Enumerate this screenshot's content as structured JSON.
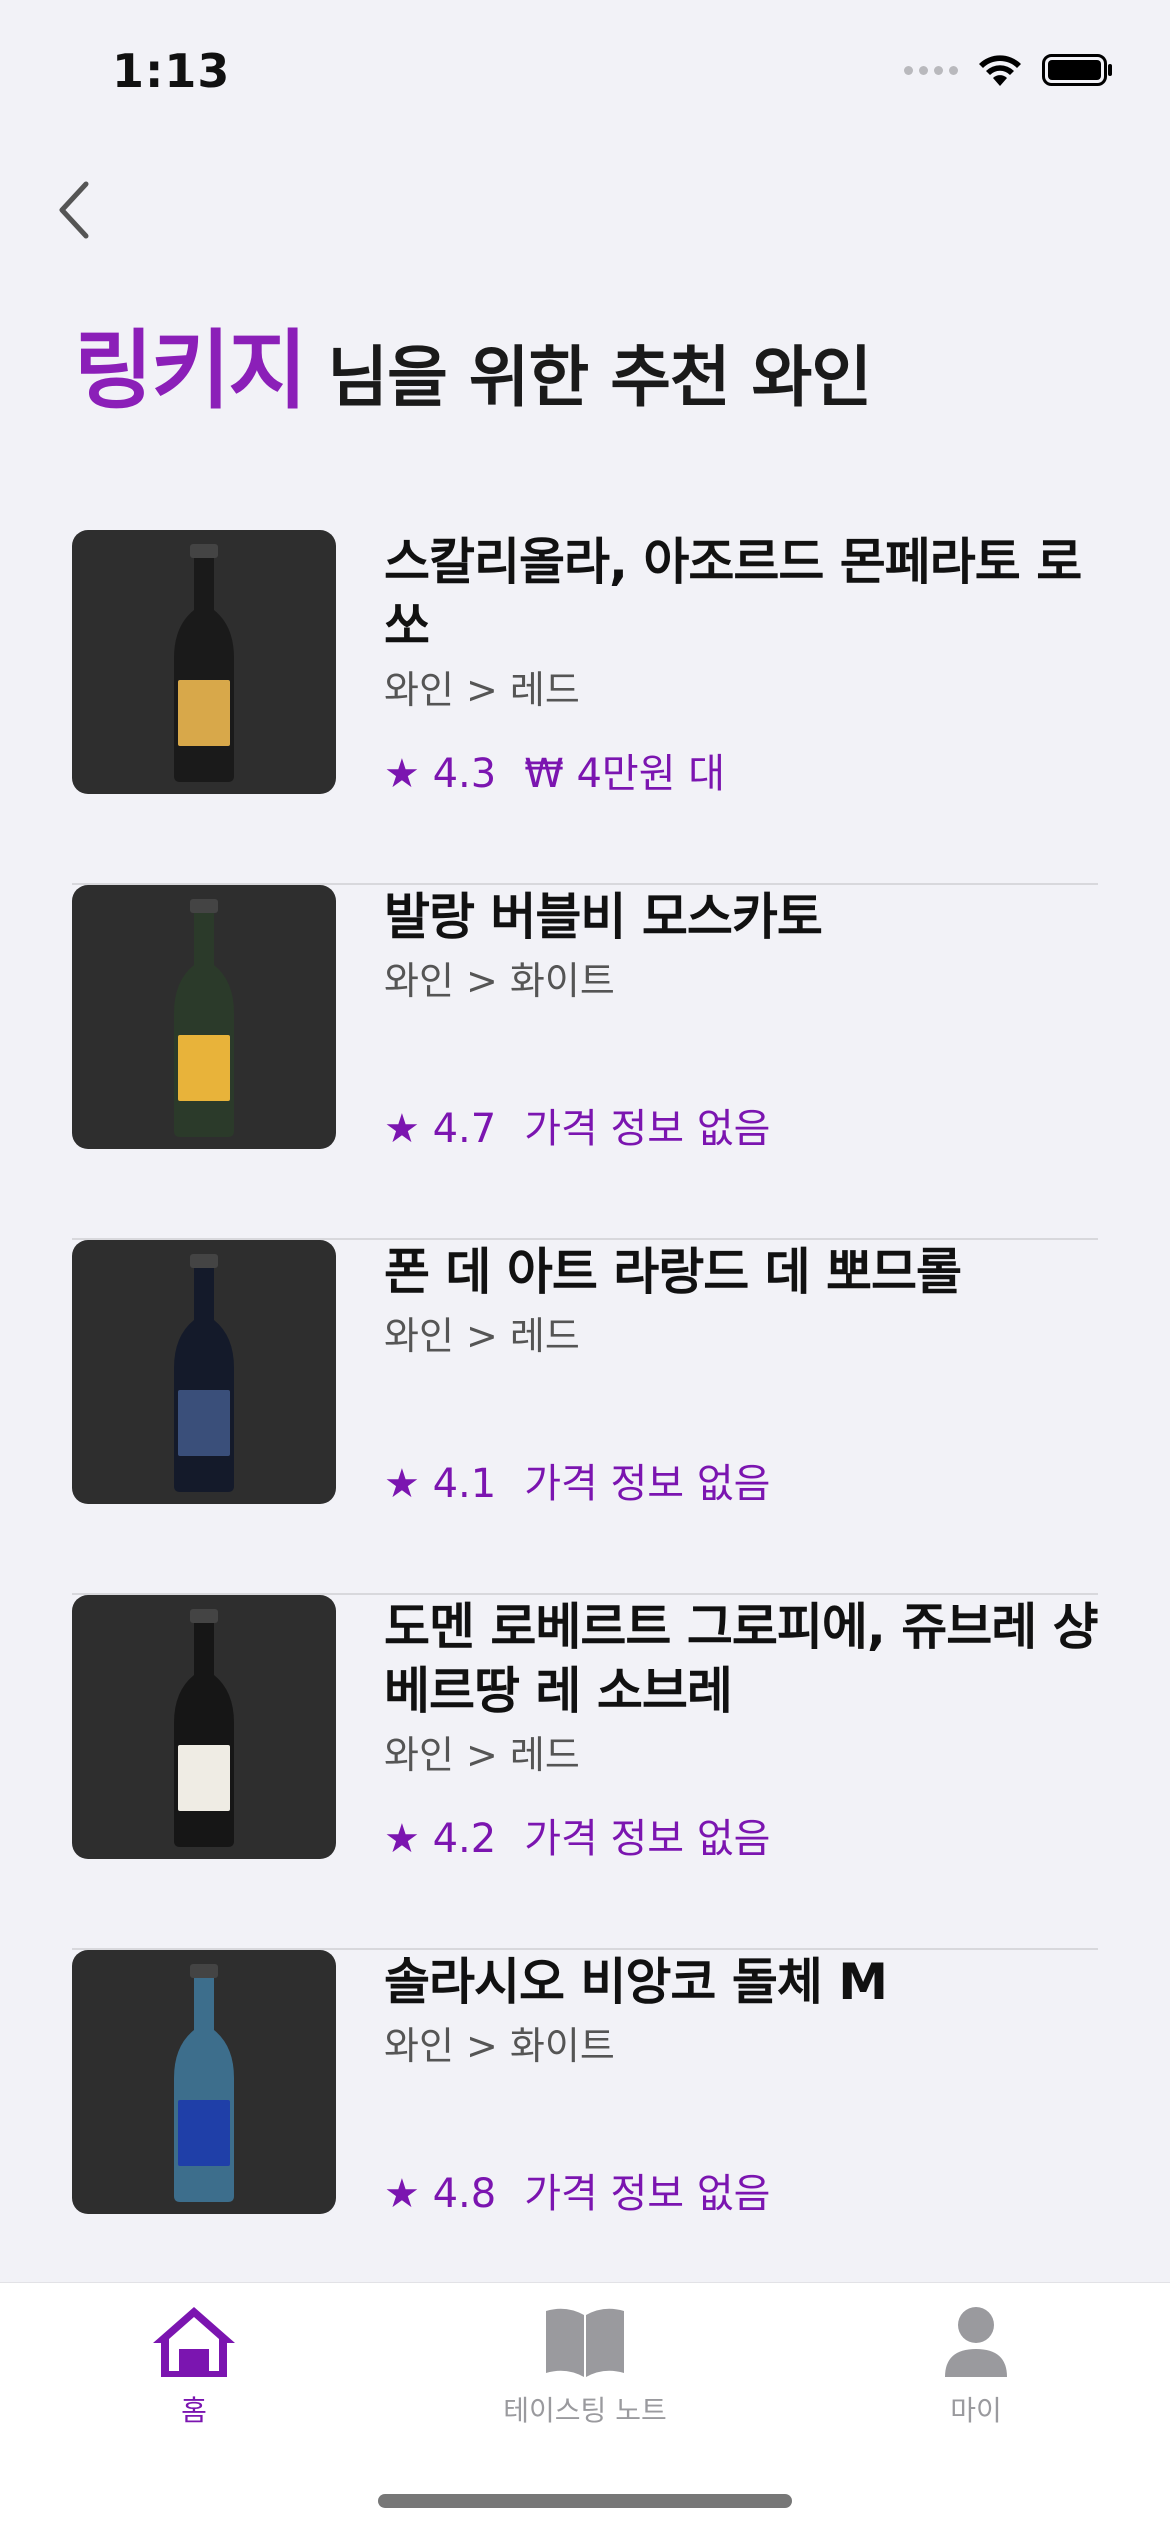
{
  "status_bar": {
    "time": "1:13"
  },
  "header": {
    "user_name": "링키지",
    "title_rest": " 님을 위한 추천 와인"
  },
  "wines": [
    {
      "name": "스칼리올라, 아조르드 몬페라토 로쏘",
      "category": "와인 > 레드",
      "rating": "★ 4.3",
      "price": "₩ 4만원 대",
      "bottle_color": "#1a1a1a",
      "label_color": "#d8a84a"
    },
    {
      "name": "발랑 버블비 모스카토",
      "category": "와인 > 화이트",
      "rating": "★ 4.7",
      "price": "가격 정보 없음",
      "bottle_color": "#2b3a2a",
      "label_color": "#e8b33a"
    },
    {
      "name": "폰 데 아트 라랑드 데 뽀므롤",
      "category": "와인 > 레드",
      "rating": "★ 4.1",
      "price": "가격 정보 없음",
      "bottle_color": "#141a2a",
      "label_color": "#3a4f7a"
    },
    {
      "name": "도멘 로베르트 그로피에, 쥬브레 샹베르땅 레 소브레",
      "category": "와인 > 레드",
      "rating": "★ 4.2",
      "price": "가격 정보 없음",
      "bottle_color": "#161616",
      "label_color": "#efece4"
    },
    {
      "name": "솔라시오 비앙코 돌체 M",
      "category": "와인 > 화이트",
      "rating": "★ 4.8",
      "price": "가격 정보 없음",
      "bottle_color": "#3d6e8c",
      "label_color": "#1f3fa8"
    }
  ],
  "tab_bar": {
    "tabs": [
      {
        "label": "홈",
        "icon": "home-icon",
        "active": true
      },
      {
        "label": "테이스팅 노트",
        "icon": "book-icon",
        "active": false
      },
      {
        "label": "마이",
        "icon": "person-icon",
        "active": false
      }
    ]
  },
  "colors": {
    "accent": "#7b15b0",
    "background": "#f2f2f7",
    "thumb_bg": "#2e2e2e"
  }
}
